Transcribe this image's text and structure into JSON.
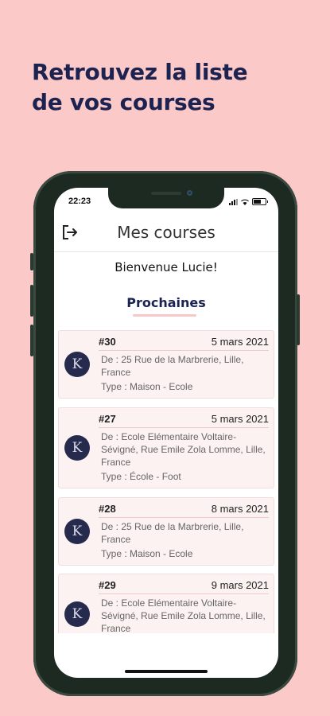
{
  "headline": {
    "line1": "Retrouvez la liste",
    "line2": "de vos courses"
  },
  "status": {
    "time": "22:23"
  },
  "appbar": {
    "title": "Mes courses"
  },
  "welcome": "Bienvenue Lucie!",
  "section_title": "Prochaines",
  "rides": [
    {
      "avatar": "K",
      "number": "#30",
      "date": "5 mars 2021",
      "from": "De : 25 Rue de la Marbrerie, Lille, France",
      "type": "Type : Maison - Ecole"
    },
    {
      "avatar": "K",
      "number": "#27",
      "date": "5 mars 2021",
      "from": "De : Ecole Elémentaire Voltaire-Sévigné, Rue Emile Zola Lomme, Lille, France",
      "type": "Type : École - Foot"
    },
    {
      "avatar": "K",
      "number": "#28",
      "date": "8 mars 2021",
      "from": "De : 25 Rue de la Marbrerie, Lille, France",
      "type": "Type : Maison - Ecole"
    },
    {
      "avatar": "K",
      "number": "#29",
      "date": "9 mars 2021",
      "from": "De : Ecole Elémentaire Voltaire-Sévigné, Rue Emile Zola Lomme, Lille, France",
      "type": ""
    }
  ],
  "colors": {
    "background": "#fbc9c8",
    "navy": "#1c2350",
    "card": "#fdf2f2",
    "avatar": "#262b4e"
  }
}
